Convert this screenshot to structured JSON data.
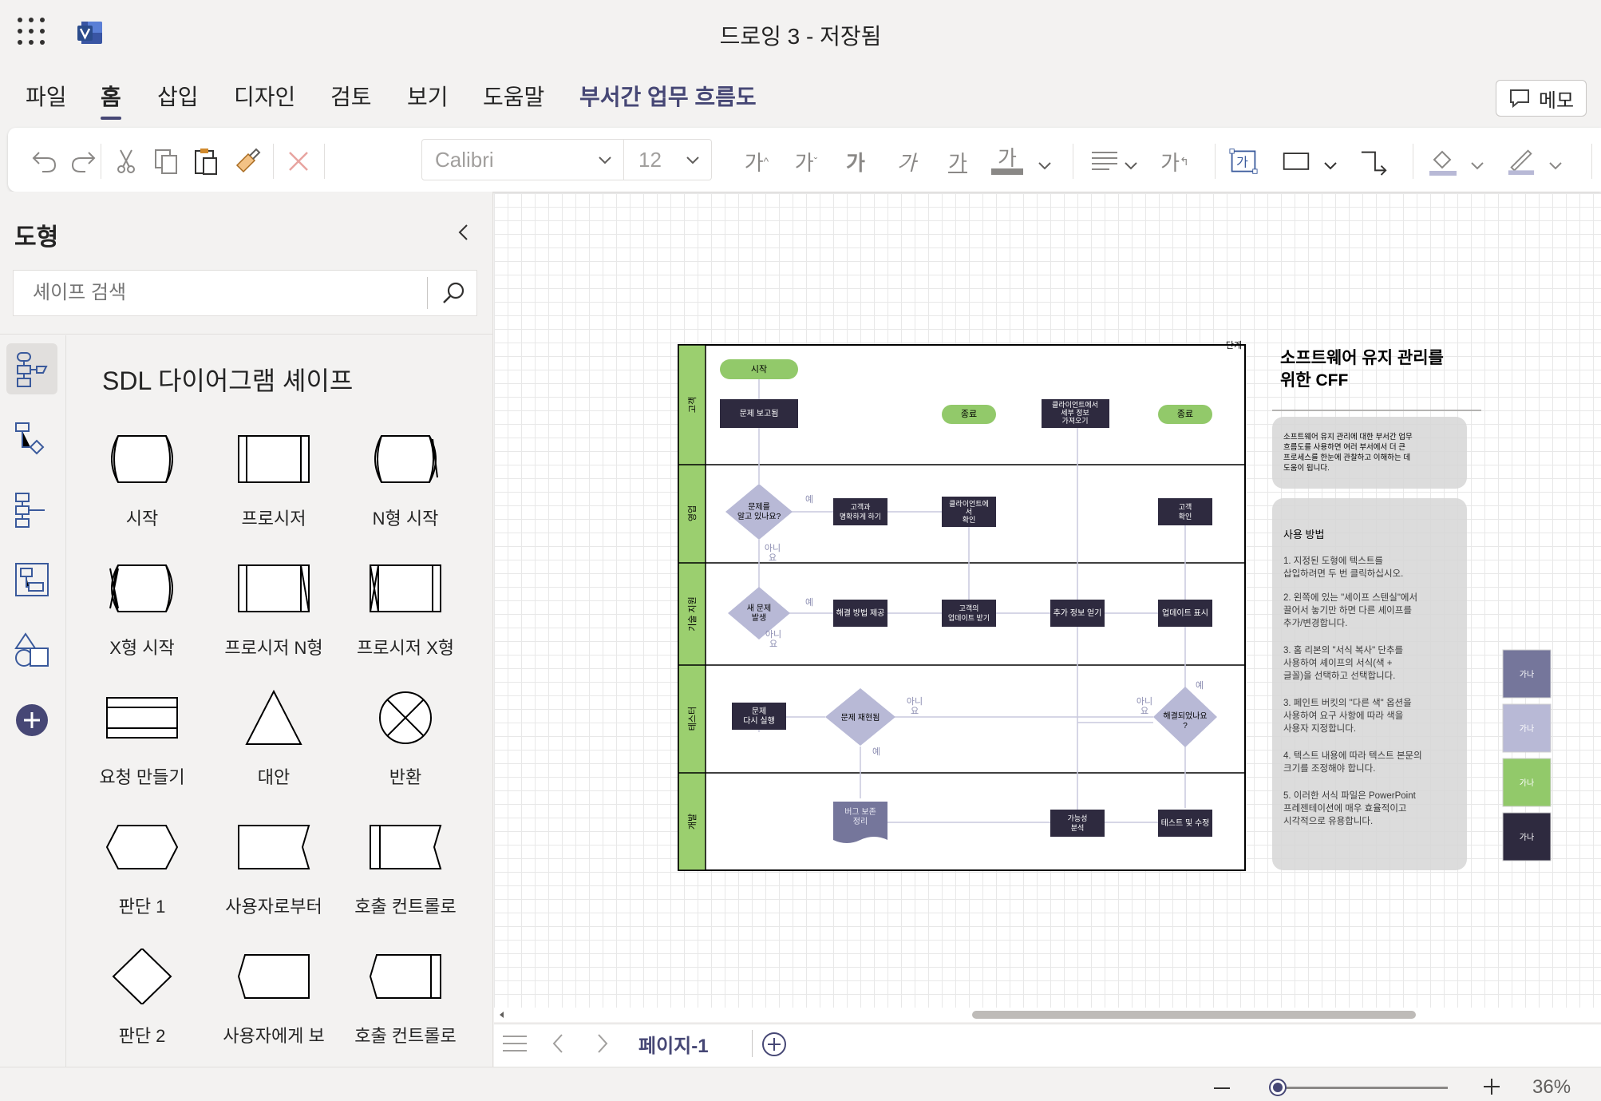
{
  "app": {
    "title": "드로잉 3  -  저장됨"
  },
  "menu": {
    "tabs": [
      "파일",
      "홈",
      "삽입",
      "디자인",
      "검토",
      "보기",
      "도움말",
      "부서간 업무 흐름도"
    ],
    "comment_label": "메모"
  },
  "toolbar": {
    "font": "Calibri",
    "size": "12"
  },
  "shapes_panel": {
    "title": "도형",
    "search_placeholder": "셰이프 검색",
    "stencil_title": "SDL 다이어그램 셰이프",
    "shapes": [
      "시작",
      "프로시저",
      "N형 시작",
      "X형 시작",
      "프로시저 N형",
      "프로시저 X형",
      "요청 만들기",
      "대안",
      "반환",
      "판단 1",
      "사용자로부터",
      "호출 컨트롤로",
      "판단 2",
      "사용자에게 보",
      "호출 컨트롤로"
    ]
  },
  "diagram": {
    "phase_label": "단계",
    "lanes": [
      "고객",
      "영업",
      "기술 지원",
      "테스터",
      "개발"
    ],
    "nodes": {
      "start": "시작",
      "report": "문제 보고됨",
      "end1": "종료",
      "fetch": [
        "클라이언트에서",
        "세부 정보",
        "가져오기"
      ],
      "end2": "종료",
      "known": [
        "문제를",
        "알고 있나요?"
      ],
      "clarify": [
        "고객과",
        "명확하게 하기"
      ],
      "client_confirm": [
        "클라이언트에",
        "서",
        "확인"
      ],
      "cust_confirm": [
        "고객",
        "확인"
      ],
      "new_issue": [
        "새 문제",
        "발생"
      ],
      "solution": "해결 방법 제공",
      "get_update": [
        "고객의",
        "업데이트 받기"
      ],
      "more_info": "추가 정보 얻기",
      "show_update": "업데이트 표시",
      "rerun": [
        "문제",
        "다시 실행"
      ],
      "reproduced": "문제 재현됨",
      "resolved": [
        "해결되었나요",
        "?"
      ],
      "bug": [
        "버그 보존",
        "정리"
      ],
      "feasibility": [
        "가능성",
        "분석"
      ],
      "test_fix": "테스트 및 수정"
    },
    "edge_labels": {
      "yes": "예",
      "no": [
        "아니",
        "요"
      ]
    }
  },
  "info_panel": {
    "title": [
      "소프트웨어 유지 관리를",
      "위한 CFF"
    ],
    "desc": [
      "소프트웨어 유지 관리에 대한 부서간 업무",
      "흐름도를 사용하면 여러 부서에서 더 큰",
      "프로세스를 한눈에 관찰하고 이해하는 데",
      "도움이 됩니다."
    ],
    "usage_title": "사용 방법",
    "steps": [
      [
        "1. 지정된 도형에 텍스트를",
        "삽입하려면 두 번 클릭하십시오."
      ],
      [
        "2. 왼쪽에 있는 \"셰이프 스텐실\"에서",
        "끌어서 놓기만 하면 다른 셰이프를",
        "추가/변경합니다."
      ],
      [
        "3. 홈 리본의 \"서식 복사\" 단추를",
        "사용하여 셰이프의 서식(색 +",
        "글꼴)을 선택하고 선택합니다."
      ],
      [
        "3. 페인트 버킷의 \"다른 색\" 옵션을",
        "사용하여 요구 사항에 따라 색을",
        "사용자 지정합니다."
      ],
      [
        "4. 텍스트 내용에 따라 텍스트 본문의",
        "크기를 조정해야 합니다."
      ],
      [
        "5. 이러한 서식 파일은 PowerPoint",
        "프레젠테이션에 매우 효율적이고",
        "시각적으로 유용합니다."
      ]
    ],
    "swatch_label": "가나",
    "swatches": [
      "#75769b",
      "#b8b9d6",
      "#92c96a",
      "#2e2a3f"
    ]
  },
  "pages": {
    "current": "페이지-1"
  },
  "status": {
    "zoom": "36%"
  },
  "colors": {
    "accent": "#464775",
    "lane": "#9bcf6f",
    "node_dark": "#2e2a3f",
    "node_light": "#b8b9d6",
    "pill": "#92c96a"
  }
}
